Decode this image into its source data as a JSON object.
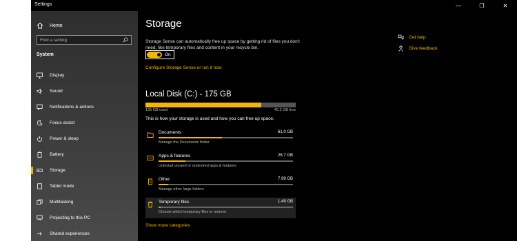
{
  "window": {
    "title": "Settings",
    "controls": {
      "minimize": "—",
      "maximize": "❐",
      "close": "✕"
    }
  },
  "sidebar": {
    "home": "Home",
    "search_placeholder": "Find a setting",
    "section": "System",
    "items": [
      {
        "label": "Display",
        "icon": "monitor-icon"
      },
      {
        "label": "Sound",
        "icon": "speaker-icon"
      },
      {
        "label": "Notifications & actions",
        "icon": "notification-icon"
      },
      {
        "label": "Focus assist",
        "icon": "moon-icon"
      },
      {
        "label": "Power & sleep",
        "icon": "power-icon"
      },
      {
        "label": "Battery",
        "icon": "battery-icon"
      },
      {
        "label": "Storage",
        "icon": "storage-icon",
        "active": true
      },
      {
        "label": "Tablet mode",
        "icon": "tablet-icon"
      },
      {
        "label": "Multitasking",
        "icon": "multitasking-icon"
      },
      {
        "label": "Projecting to this PC",
        "icon": "projector-icon"
      },
      {
        "label": "Shared experiences",
        "icon": "shared-icon"
      }
    ]
  },
  "main": {
    "title": "Storage",
    "description": "Storage Sense can automatically free up space by getting rid of files you don't need, like temporary files and content in your recycle bin.",
    "toggle_label": "On",
    "toggle_on": true,
    "configure_link": "Configure Storage Sense or run it now",
    "disk_title": "Local Disk (C:) - 175 GB",
    "disk_used_fraction": 0.77,
    "used_label": "135 GB used",
    "free_label": "40.2 GB free",
    "info": "This is how your storage is used and how you can free up space.",
    "categories": [
      {
        "name": "Documents",
        "size": "61.0 GB",
        "sub": "Manage the Documents folder",
        "fraction": 0.47,
        "icon": "documents-icon"
      },
      {
        "name": "Apps & features",
        "size": "26.7 GB",
        "sub": "Uninstall unused or undesired apps & features",
        "fraction": 0.2,
        "icon": "apps-icon"
      },
      {
        "name": "Other",
        "size": "7.99 GB",
        "sub": "Manage other large folders",
        "fraction": 0.07,
        "icon": "other-icon"
      },
      {
        "name": "Temporary files",
        "size": "1.49 GB",
        "sub": "Choose which temporary files to remove",
        "fraction": 0.015,
        "icon": "trash-icon"
      }
    ],
    "show_more": "Show more categories"
  },
  "help": {
    "get_help": "Get help",
    "give_feedback": "Give feedback"
  },
  "colors": {
    "accent": "#f5b500",
    "background": "#000000",
    "sidebar": "#3a3a3a",
    "temp_bar": "#8bc34a"
  }
}
